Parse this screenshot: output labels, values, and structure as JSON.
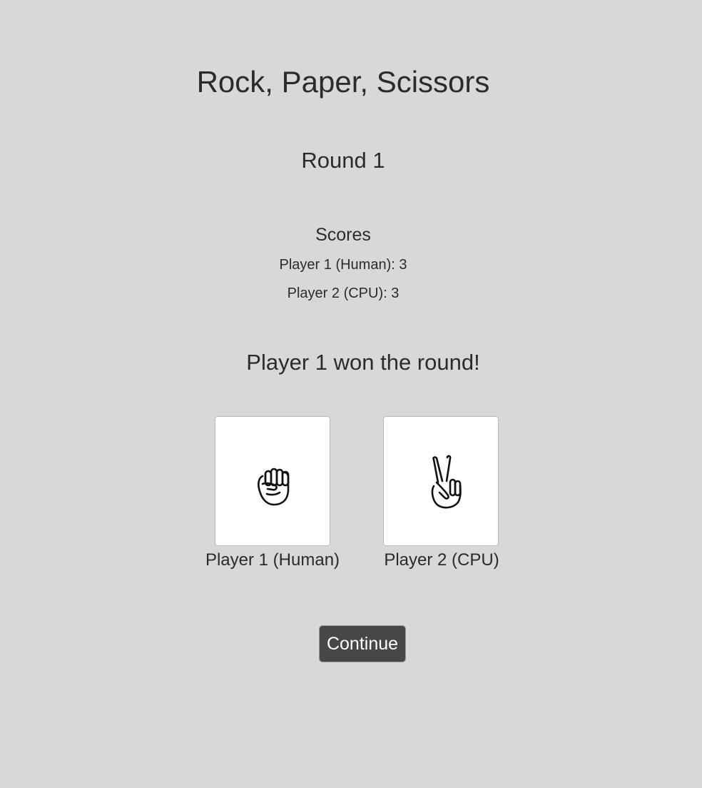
{
  "game": {
    "title": "Rock, Paper, Scissors",
    "round_label": "Round 1"
  },
  "scores": {
    "heading": "Scores",
    "player1": "Player 1 (Human): 3",
    "player2": "Player 2 (CPU): 3"
  },
  "result": {
    "message": "Player 1 won the round!"
  },
  "players": [
    {
      "label": "Player 1 (Human)",
      "choice_icon": "rock-fist-icon"
    },
    {
      "label": "Player 2 (CPU)",
      "choice_icon": "scissors-peace-icon"
    }
  ],
  "actions": {
    "continue_label": "Continue"
  },
  "colors": {
    "background": "#d8d8d8",
    "text": "#2b2b2b",
    "card": "#ffffff",
    "button": "#474747",
    "button_text": "#ffffff"
  }
}
